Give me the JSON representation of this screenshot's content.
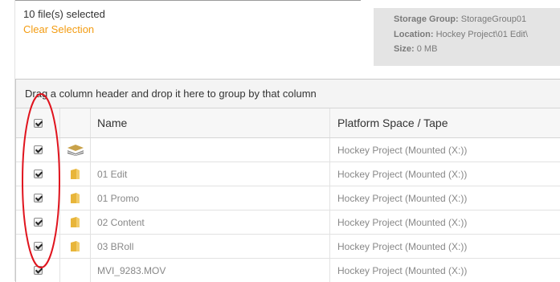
{
  "selection": {
    "count_text": "10 file(s) selected",
    "clear_label": "Clear Selection"
  },
  "info": {
    "storage_group_label": "Storage Group:",
    "storage_group_value": "StorageGroup01",
    "location_label": "Location:",
    "location_value": "Hockey Project\\01 Edit\\",
    "size_label": "Size:",
    "size_value": "0 MB"
  },
  "grid": {
    "group_bar_text": "Drag a column header and drop it here to group by that column",
    "columns": {
      "name": "Name",
      "platform": "Platform Space / Tape"
    },
    "rows": [
      {
        "checked": true,
        "icon": "storage-layers-icon",
        "name": "",
        "platform": "Hockey Project (Mounted (X:))"
      },
      {
        "checked": true,
        "icon": "folder-icon",
        "name": "01 Edit",
        "platform": "Hockey Project (Mounted (X:))"
      },
      {
        "checked": true,
        "icon": "folder-icon",
        "name": "01 Promo",
        "platform": "Hockey Project (Mounted (X:))"
      },
      {
        "checked": true,
        "icon": "folder-icon",
        "name": "02 Content",
        "platform": "Hockey Project (Mounted (X:))"
      },
      {
        "checked": true,
        "icon": "folder-icon",
        "name": "03 BRoll",
        "platform": "Hockey Project (Mounted (X:))"
      },
      {
        "checked": true,
        "icon": "",
        "name": "MVI_9283.MOV",
        "platform": "Hockey Project (Mounted (X:))"
      }
    ]
  },
  "colors": {
    "accent_link": "#f39c12",
    "annotation": "#e0141e",
    "info_box_bg": "#e4e4e4",
    "folder": "#e8b53a"
  }
}
